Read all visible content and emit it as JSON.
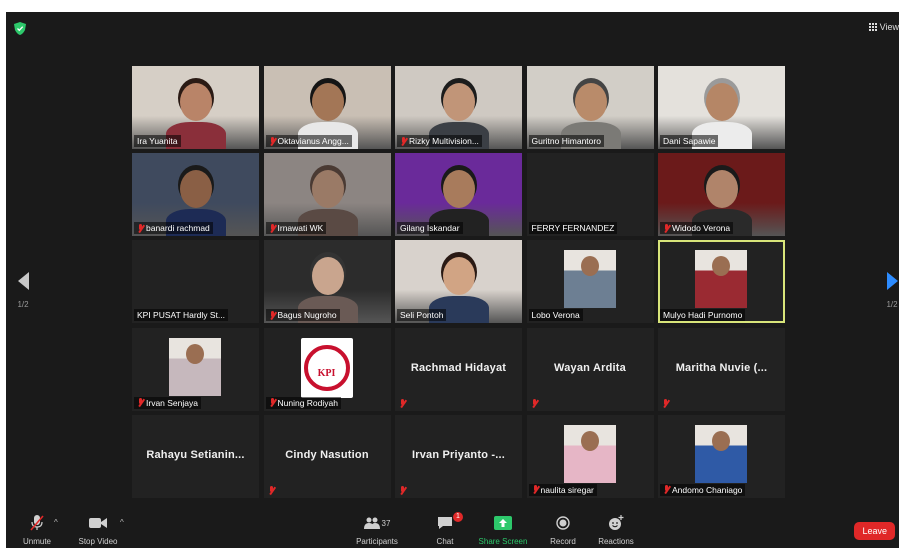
{
  "topbar": {
    "view_label": "View"
  },
  "pagination": {
    "left_page": "1/2",
    "right_page": "1/2"
  },
  "participants": [
    {
      "name": "Ira Yuanita",
      "muted": false,
      "video": true,
      "skin": "#b98468",
      "hair": "#2a1a14",
      "shirt": "#8a2f3a",
      "bg": "#d6cfc6"
    },
    {
      "name": "Oktavianus Angg...",
      "muted": true,
      "video": true,
      "skin": "#a37656",
      "hair": "#151515",
      "shirt": "#e8e8e8",
      "bg": "#c9bfb4"
    },
    {
      "name": "Rizky Multivision...",
      "muted": true,
      "video": true,
      "skin": "#c19578",
      "hair": "#1c1c1c",
      "shirt": "#3b3f45",
      "bg": "#cfc9c2"
    },
    {
      "name": "Guritno Himantoro",
      "muted": false,
      "video": true,
      "skin": "#b98b6a",
      "hair": "#444",
      "shirt": "#7b7a76",
      "bg": "#d2cec7"
    },
    {
      "name": "Dani Sapawie",
      "muted": false,
      "video": true,
      "skin": "#b58666",
      "hair": "#9a9a9a",
      "shirt": "#ececec",
      "bg": "#e4e1dc"
    },
    {
      "name": "banardi rachmad",
      "muted": true,
      "video": true,
      "skin": "#8a5f45",
      "hair": "#1a1a1a",
      "shirt": "#1d2b55",
      "bg": "#3f4a5e"
    },
    {
      "name": "Irnawati WK",
      "muted": true,
      "video": true,
      "skin": "#9a7a66",
      "hair": "#4a3a33",
      "shirt": "#5a4a44",
      "bg": "#8c8582"
    },
    {
      "name": "Gilang Iskandar",
      "muted": false,
      "video": true,
      "skin": "#a87b5c",
      "hair": "#1a1a1a",
      "shirt": "#222",
      "bg": "#6a2a9a"
    },
    {
      "name": "FERRY FERNANDEZ",
      "muted": false,
      "video": false,
      "photo": false
    },
    {
      "name": "Widodo Verona",
      "muted": true,
      "video": true,
      "skin": "#b0846a",
      "hair": "#1a1a1a",
      "shirt": "#2a2a2a",
      "bg": "#6b1a1a"
    },
    {
      "name": "KPI PUSAT Hardly St...",
      "muted": false,
      "video": false,
      "photo": false
    },
    {
      "name": "Bagus Nugroho",
      "muted": true,
      "video": true,
      "skin": "#c9a58e",
      "hair": "#333",
      "shirt": "#6a5a55",
      "bg": "#2c2c2c"
    },
    {
      "name": "Seli Pontoh",
      "muted": false,
      "video": true,
      "skin": "#d1a484",
      "hair": "#2a1a14",
      "shirt": "#2a3a5a",
      "bg": "#d8d2cc"
    },
    {
      "name": "Lobo Verona",
      "muted": false,
      "video": false,
      "photo": true,
      "photo_color": "#6d7f93"
    },
    {
      "name": "Mulyo Hadi Purnomo",
      "muted": false,
      "video": false,
      "photo": true,
      "photo_color": "#9a2a32",
      "active": true
    },
    {
      "name": "Irvan Senjaya",
      "muted": true,
      "video": false,
      "photo": true,
      "photo_color": "#c6b8bd"
    },
    {
      "name": "Nuning Rodiyah",
      "muted": true,
      "video": false,
      "photo": true,
      "photo_color": "#ffffff",
      "kpi_logo": "KPI"
    },
    {
      "name": "Rachmad Hidayat",
      "muted": true,
      "video": false,
      "photo": false,
      "big": true
    },
    {
      "name": "Wayan Ardita",
      "muted": true,
      "video": false,
      "photo": false,
      "big": true
    },
    {
      "name": "Maritha Nuvie (...",
      "muted": true,
      "video": false,
      "photo": false,
      "big": true
    },
    {
      "name": "Rahayu  Setianin...",
      "muted": false,
      "video": false,
      "photo": false,
      "big": true
    },
    {
      "name": "Cindy Nasution",
      "muted": true,
      "video": false,
      "photo": false,
      "big": true
    },
    {
      "name": "Irvan Priyanto -...",
      "muted": true,
      "video": false,
      "photo": false,
      "big": true
    },
    {
      "name": "naulita siregar",
      "muted": true,
      "video": false,
      "photo": true,
      "photo_color": "#e6b6c6"
    },
    {
      "name": "Andomo Chaniago",
      "muted": true,
      "video": false,
      "photo": true,
      "photo_color": "#2f5aa6"
    }
  ],
  "toolbar": {
    "unmute_label": "Unmute",
    "stop_video_label": "Stop Video",
    "participants_label": "Participants",
    "participants_count": "37",
    "chat_label": "Chat",
    "chat_badge": "1",
    "share_label": "Share Screen",
    "record_label": "Record",
    "reactions_label": "Reactions",
    "leave_label": "Leave"
  },
  "colors": {
    "accent": "#2d8cff",
    "share": "#2dc86b",
    "danger": "#e02828",
    "active_speaker": "#d8e57a"
  }
}
